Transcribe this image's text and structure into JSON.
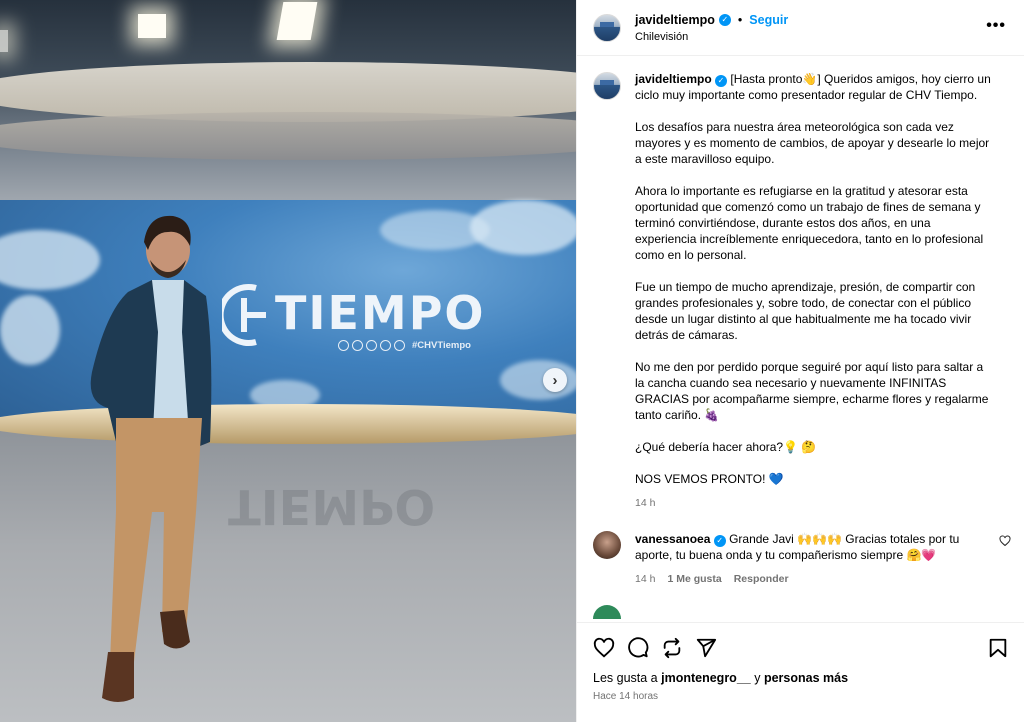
{
  "post": {
    "username": "javideltiempo",
    "follow_label": "Seguir",
    "location": "Chilevisión",
    "more_label": "•••"
  },
  "photo": {
    "logo_text": "TIEMPO",
    "hashtag": "#CHVTiempo",
    "reflection_text": "TIEMPO"
  },
  "caption": {
    "username": "javideltiempo",
    "paragraphs": [
      "[Hasta pronto👋] Queridos amigos, hoy cierro un ciclo muy importante como presentador regular de CHV Tiempo.",
      "Los desafíos para nuestra área meteorológica son cada vez mayores y es momento de cambios, de apoyar y desearle lo mejor a este maravilloso equipo.",
      "Ahora lo importante es refugiarse en la gratitud y atesorar esta oportunidad que comenzó como un trabajo de fines de semana y terminó convirtiéndose, durante estos dos años, en una experiencia increíblemente enriquecedora, tanto en lo profesional como en lo personal.",
      "Fue un tiempo de mucho aprendizaje, presión, de compartir con grandes profesionales y, sobre todo, de conectar con el público desde un lugar distinto al que habitualmente me ha tocado vivir detrás de cámaras.",
      "No me den por perdido porque seguiré por aquí listo para saltar a la cancha cuando sea necesario y nuevamente INFINITAS GRACIAS por acompañarme siempre, echarme flores y regalarme tanto cariño. 🍇",
      "¿Qué debería hacer ahora?💡 🤔",
      "NOS VEMOS PRONTO! 💙"
    ],
    "time": "14 h"
  },
  "comment": {
    "username": "vanessanoea",
    "text": "Grande Javi 🙌🙌🙌 Gracias totales por tu aporte, tu buena onda y tu compañerismo siempre 🤗💗",
    "time": "14 h",
    "likes": "1 Me gusta",
    "reply_label": "Responder"
  },
  "footer": {
    "likes_prefix": "Les gusta a",
    "likes_user": "jmontenegro__",
    "likes_mid": "y",
    "likes_others": "personas más",
    "posted_ago": "Hace 14 horas"
  },
  "colors": {
    "accent": "#0095f6",
    "meta": "#737373",
    "divider": "#efefef"
  },
  "icons": [
    "heart-icon",
    "comment-icon",
    "share-icon",
    "send-icon",
    "bookmark-icon",
    "verified-icon",
    "more-icon",
    "chevron-right-icon"
  ]
}
